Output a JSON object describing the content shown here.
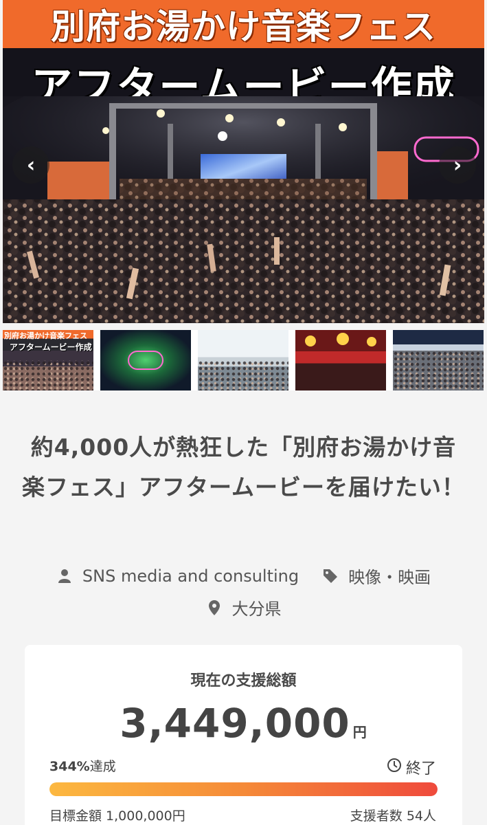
{
  "hero": {
    "banner_text": "別府お湯かけ音楽フェス",
    "subtitle": "アフタームービー作成",
    "nav": {
      "prev_icon": "chevron-left-icon",
      "next_icon": "chevron-right-icon",
      "prev_symbol": "‹",
      "next_symbol": "›"
    }
  },
  "thumbnails": [
    {
      "caption": "別府お湯かけ音楽フェス",
      "caption2": "アフタームービー作成"
    },
    {
      "caption": ""
    },
    {
      "caption": ""
    },
    {
      "caption": ""
    },
    {
      "caption": ""
    }
  ],
  "project": {
    "title": "約4,000人が熱狂した「別府お湯かけ音楽フェス」アフタームービーを届けたい！",
    "owner": "SNS media and consulting",
    "category": "映像・映画",
    "location": "大分県"
  },
  "funding": {
    "label": "現在の支援総額",
    "amount": "3,449,000",
    "currency": "円",
    "achievement_value": "344%",
    "achievement_suffix": "達成",
    "status": "終了",
    "progress_fraction": 1.0,
    "goal": "目標金額 1,000,000円",
    "backers": "支援者数 54人"
  },
  "colors": {
    "banner": "#f06a2b",
    "page_bg": "#f4f4f4",
    "text": "#4a4a4a",
    "progress_start": "#fcb840",
    "progress_end": "#ef4a3c"
  }
}
